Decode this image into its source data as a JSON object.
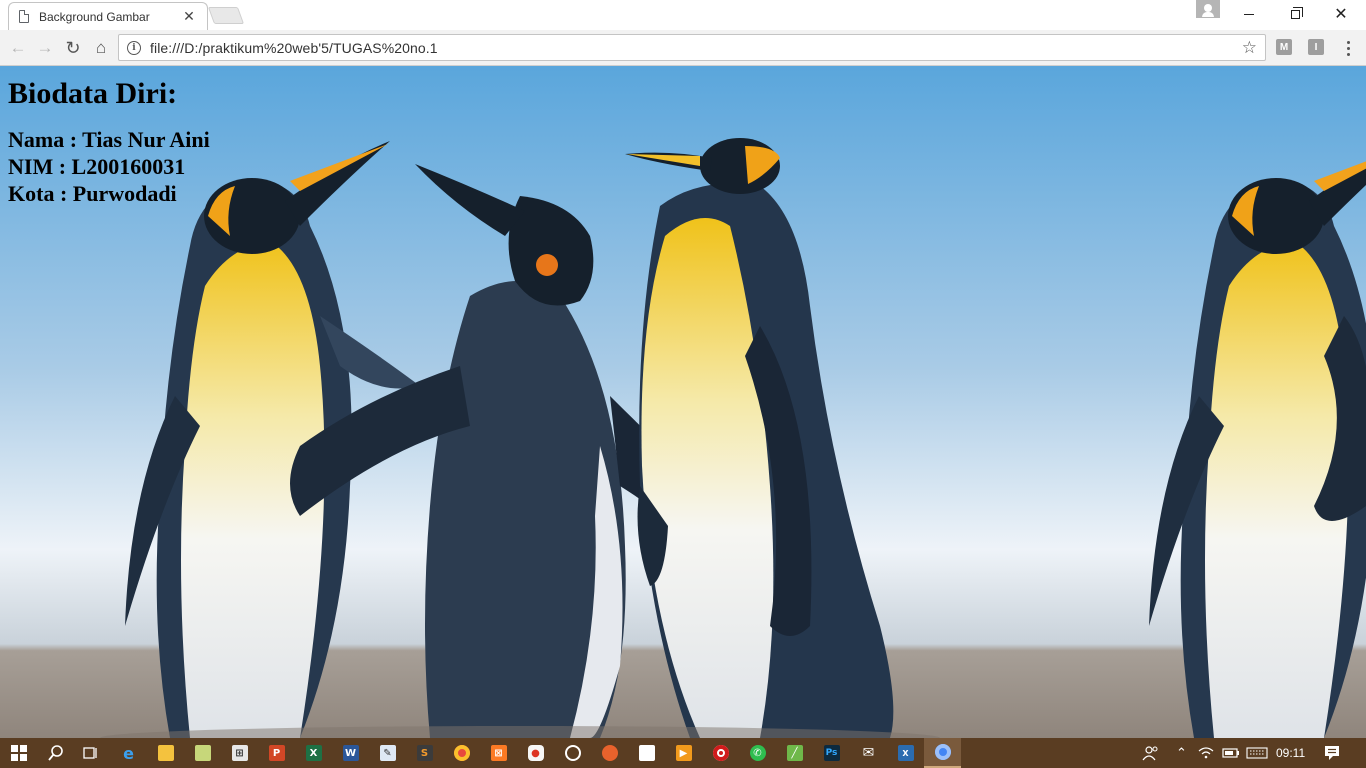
{
  "browser": {
    "tab_title": "Background Gambar",
    "tab_close": "✕",
    "url": "file:///D:/praktikum%20web'5/TUGAS%20no.1",
    "star": "☆",
    "ext_m": "M",
    "ext_i": "I",
    "nav": {
      "back": "←",
      "forward": "→",
      "reload": "↻",
      "home": "⌂"
    },
    "window": {
      "close": "✕"
    }
  },
  "page": {
    "heading": "Biodata Diri:",
    "lines": [
      "Nama : Tias Nur Aini",
      "NIM : L200160031",
      "Kota : Purwodadi"
    ],
    "background": "penguins"
  },
  "taskbar": {
    "time": "09:11",
    "apps": [
      "start",
      "search",
      "task-view",
      "edge",
      "file-explorer",
      "notepad",
      "store",
      "powerpoint",
      "excel",
      "word",
      "paint",
      "sublime",
      "chrome",
      "xampp",
      "app-red",
      "app-circle",
      "firefox",
      "app-sticky",
      "media-player",
      "opera",
      "whatsapp",
      "app-green",
      "photoshop",
      "mail",
      "xmind",
      "chrome-active"
    ]
  },
  "colors": {
    "taskbar": "#5a3d22",
    "sky": "#6fb0dc",
    "sand": "#9a9088"
  }
}
